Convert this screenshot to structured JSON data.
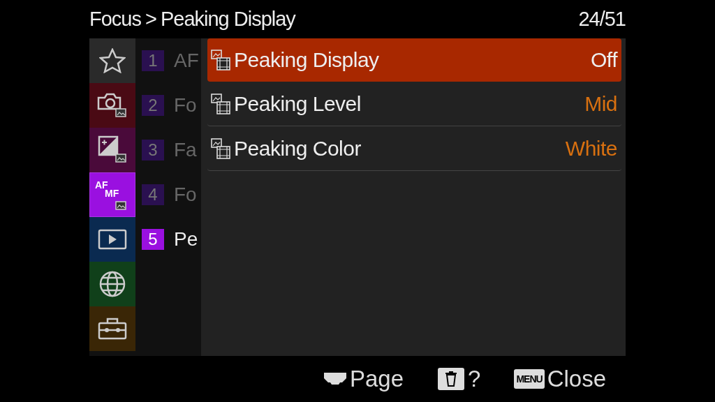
{
  "header": {
    "breadcrumb": "Focus",
    "separator": ">",
    "title": "Peaking Display",
    "page_count": "24/51"
  },
  "categories": [
    {
      "kind": "star",
      "color": "#2a2a2a",
      "selected": false
    },
    {
      "kind": "camera",
      "color": "#4a0a14",
      "selected": false
    },
    {
      "kind": "exposure",
      "color": "#4a0a3a",
      "selected": false
    },
    {
      "kind": "afmf",
      "color": "#9a10e0",
      "selected": true,
      "af": "AF",
      "mf": "MF"
    },
    {
      "kind": "play",
      "color": "#0a2a50",
      "selected": false
    },
    {
      "kind": "globe",
      "color": "#10401a",
      "selected": false
    },
    {
      "kind": "toolbox",
      "color": "#3a2606",
      "selected": false
    }
  ],
  "pages": [
    {
      "number": "1",
      "label": "AF",
      "selected": false
    },
    {
      "number": "2",
      "label": "Fo",
      "selected": false
    },
    {
      "number": "3",
      "label": "Fa",
      "selected": false
    },
    {
      "number": "4",
      "label": "Fo",
      "selected": false
    },
    {
      "number": "5",
      "label": "Pe",
      "selected": true
    }
  ],
  "settings": [
    {
      "label": "Peaking Display",
      "value": "Off",
      "selected": true
    },
    {
      "label": "Peaking Level",
      "value": "Mid",
      "selected": false
    },
    {
      "label": "Peaking Color",
      "value": "White",
      "selected": false
    }
  ],
  "footer": {
    "page": "Page",
    "help": "?",
    "menu_key": "MENU",
    "close": "Close"
  }
}
